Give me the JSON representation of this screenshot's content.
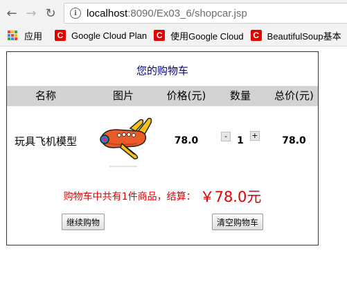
{
  "browser": {
    "url_host": "localhost",
    "url_path": ":8090/Ex03_6/shopcar.jsp",
    "bookmarks": {
      "apps_label": "应用",
      "items": [
        "Google Cloud Plan",
        "使用Google Cloud",
        "BeautifulSoup基本"
      ]
    }
  },
  "page": {
    "title": "您的购物车",
    "columns": [
      "名称",
      "图片",
      "价格(元)",
      "数量",
      "总价(元)"
    ],
    "items": [
      {
        "name": "玩具飞机模型",
        "image": "toy-airplane",
        "price": "78.0",
        "quantity": "1",
        "total": "78.0"
      }
    ],
    "qty_minus": "-",
    "qty_plus": "+",
    "summary_text": "购物车中共有1件商品，结算：",
    "summary_amount": "￥78.0元",
    "continue_button": "继续购物",
    "clear_button": "清空购物车"
  },
  "colors": {
    "title": "#00008b",
    "summary": "#e00000",
    "header_bg": "#d3d3d3"
  }
}
